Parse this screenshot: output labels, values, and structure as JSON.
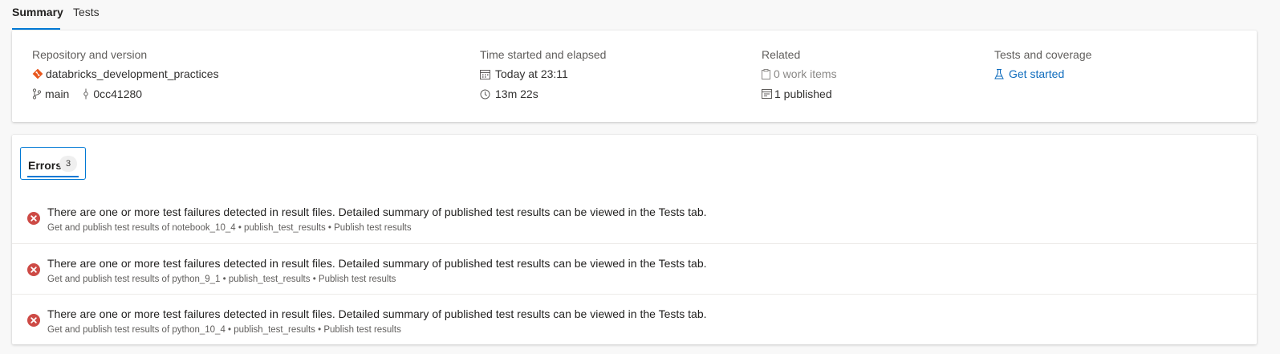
{
  "tabs": [
    {
      "label": "Summary",
      "active": true
    },
    {
      "label": "Tests",
      "active": false
    }
  ],
  "summary": {
    "repository": {
      "label": "Repository and version",
      "repo_name": "databricks_development_practices",
      "branch": "main",
      "commit": "0cc41280",
      "icons": [
        "git-repo-icon",
        "branch-icon",
        "commit-icon"
      ]
    },
    "time": {
      "label": "Time started and elapsed",
      "started": "Today at 23:11",
      "elapsed": "13m 22s",
      "icons": [
        "calendar-icon",
        "clock-icon"
      ]
    },
    "related": {
      "label": "Related",
      "work_items": "0 work items",
      "published": "1 published",
      "icons": [
        "clipboard-icon",
        "artifact-icon"
      ]
    },
    "tests": {
      "label": "Tests and coverage",
      "link": "Get started",
      "icons": [
        "flask-icon"
      ]
    }
  },
  "errors": {
    "tab_label": "Errors",
    "count": "3",
    "items": [
      {
        "message": "There are one or more test failures detected in result files. Detailed summary of published test results can be viewed in the Tests tab.",
        "source": "Get and publish test results of notebook_10_4 • publish_test_results • Publish test results"
      },
      {
        "message": "There are one or more test failures detected in result files. Detailed summary of published test results can be viewed in the Tests tab.",
        "source": "Get and publish test results of python_9_1 • publish_test_results • Publish test results"
      },
      {
        "message": "There are one or more test failures detected in result files. Detailed summary of published test results can be viewed in the Tests tab.",
        "source": "Get and publish test results of python_10_4 • publish_test_results • Publish test results"
      }
    ]
  },
  "colors": {
    "accent": "#0078d4",
    "link": "#0f6cbd",
    "error": "#cd4a45",
    "git_orange": "#e8561c"
  }
}
